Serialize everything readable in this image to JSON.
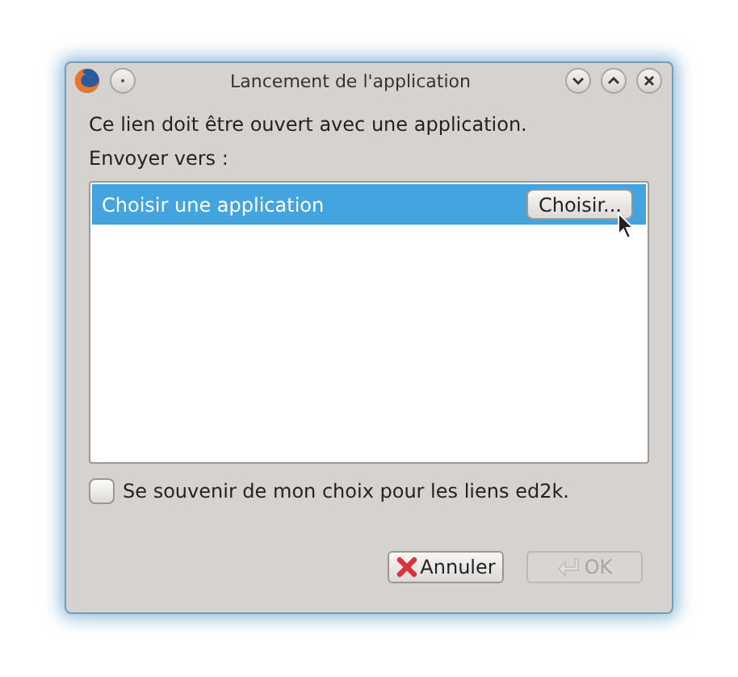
{
  "window": {
    "title": "Lancement de l'application"
  },
  "message": "Ce lien doit être ouvert avec une application.",
  "send_to_label": "Envoyer vers :",
  "list": {
    "items": [
      {
        "label": "Choisir une application",
        "selected": true,
        "button": "Choisir..."
      }
    ]
  },
  "remember": {
    "label": "Se souvenir de mon choix pour les liens ed2k.",
    "checked": false
  },
  "buttons": [
    {
      "label": "Annuler",
      "kind": "cancel",
      "disabled": false
    },
    {
      "label": "OK",
      "kind": "ok",
      "disabled": true
    }
  ]
}
